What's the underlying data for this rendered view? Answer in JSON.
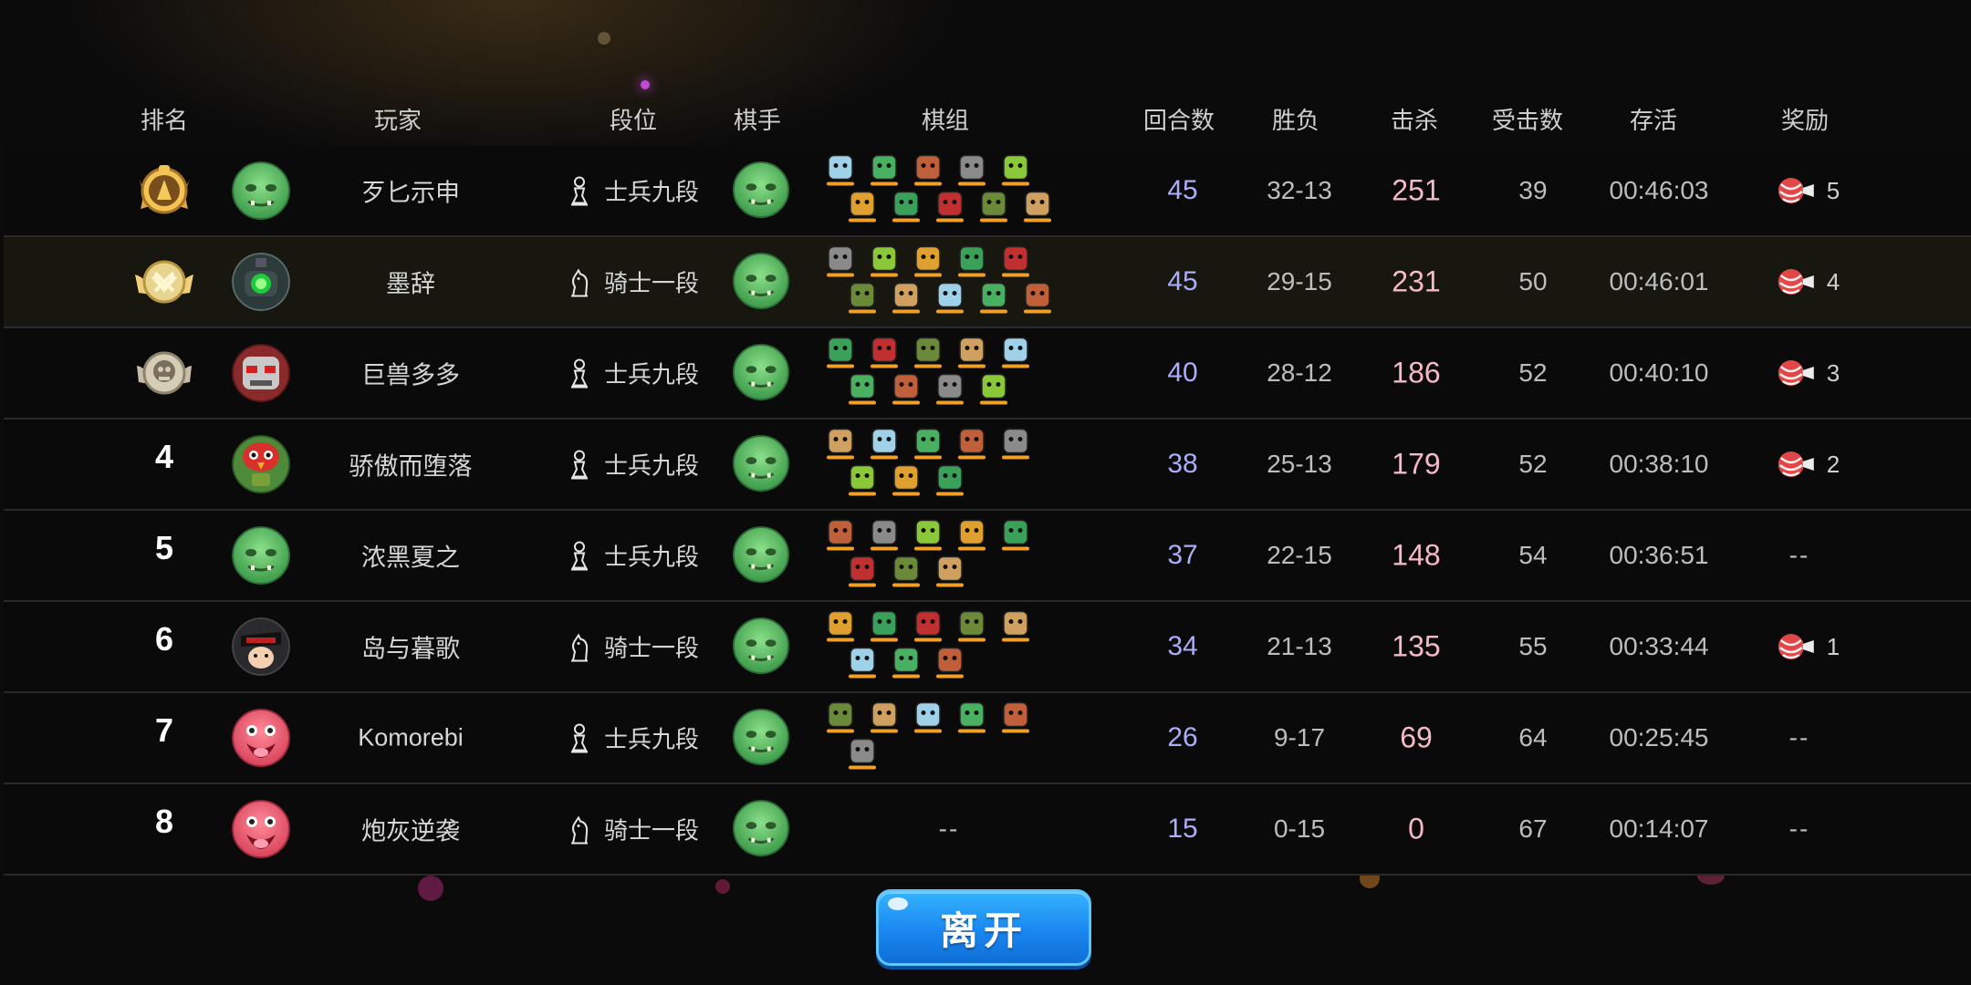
{
  "headers": {
    "rank": "排名",
    "player": "玩家",
    "tier": "段位",
    "chess_player": "棋手",
    "lineup": "棋组",
    "rounds": "回合数",
    "win_loss": "胜负",
    "kills": "击杀",
    "hits_taken": "受击数",
    "survival": "存活",
    "reward": "奖励"
  },
  "rows": [
    {
      "rank": "1",
      "medal": "gold-medal-icon",
      "avatar": "green-ogre-avatar",
      "name": "歹匕示申",
      "tier_icon": "pawn-icon",
      "tier": "士兵九段",
      "pieces": 10,
      "rounds": "45",
      "wl": "32-13",
      "kills": "251",
      "hits": "39",
      "survival": "00:46:03",
      "reward": "5"
    },
    {
      "rank": "2",
      "medal": "silver-medal-icon",
      "avatar": "robot-eye-avatar",
      "name": "墨辞",
      "tier_icon": "knight-icon",
      "tier": "骑士一段",
      "pieces": 10,
      "rounds": "45",
      "wl": "29-15",
      "kills": "231",
      "hits": "50",
      "survival": "00:46:01",
      "reward": "4"
    },
    {
      "rank": "3",
      "medal": "bronze-medal-icon",
      "avatar": "red-skull-avatar",
      "name": "巨兽多多",
      "tier_icon": "pawn-icon",
      "tier": "士兵九段",
      "pieces": 9,
      "rounds": "40",
      "wl": "28-12",
      "kills": "186",
      "hits": "52",
      "survival": "00:40:10",
      "reward": "3"
    },
    {
      "rank": "4",
      "medal": "",
      "avatar": "parrot-avatar",
      "name": "骄傲而堕落",
      "tier_icon": "pawn-icon",
      "tier": "士兵九段",
      "pieces": 8,
      "rounds": "38",
      "wl": "25-13",
      "kills": "179",
      "hits": "52",
      "survival": "00:38:10",
      "reward": "2"
    },
    {
      "rank": "5",
      "medal": "",
      "avatar": "green-ogre-avatar",
      "name": "浓黑夏之",
      "tier_icon": "pawn-icon",
      "tier": "士兵九段",
      "pieces": 8,
      "rounds": "37",
      "wl": "22-15",
      "kills": "148",
      "hits": "54",
      "survival": "00:36:51",
      "reward": "--"
    },
    {
      "rank": "6",
      "medal": "",
      "avatar": "ninja-avatar",
      "name": "岛与暮歌",
      "tier_icon": "knight-icon",
      "tier": "骑士一段",
      "pieces": 8,
      "rounds": "34",
      "wl": "21-13",
      "kills": "135",
      "hits": "55",
      "survival": "00:33:44",
      "reward": "1"
    },
    {
      "rank": "7",
      "medal": "",
      "avatar": "pink-monster-avatar",
      "name": "Komorebi",
      "tier_icon": "pawn-icon",
      "tier": "士兵九段",
      "pieces": 6,
      "rounds": "26",
      "wl": "9-17",
      "kills": "69",
      "hits": "64",
      "survival": "00:25:45",
      "reward": "--"
    },
    {
      "rank": "8",
      "medal": "",
      "avatar": "pink-monster-avatar",
      "name": "炮灰逆袭",
      "tier_icon": "knight-icon",
      "tier": "骑士一段",
      "pieces": 0,
      "lineup_empty": "--",
      "rounds": "15",
      "wl": "0-15",
      "kills": "0",
      "hits": "67",
      "survival": "00:14:07",
      "reward": "--"
    }
  ],
  "leave_button": "离开",
  "colors": {
    "rounds": "#a9aef6",
    "kills": "#f6b9c6",
    "button": "#1a86f0",
    "highlight_row": "#17170f"
  }
}
